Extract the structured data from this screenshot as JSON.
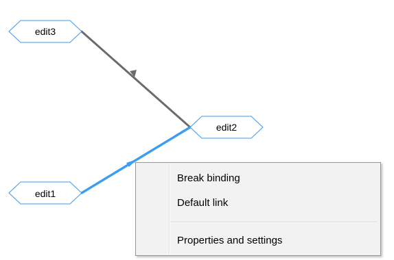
{
  "graph": {
    "nodes": [
      {
        "id": "edit3",
        "label": "edit3"
      },
      {
        "id": "edit2",
        "label": "edit2"
      },
      {
        "id": "edit1",
        "label": "edit1"
      }
    ],
    "links": [
      {
        "from": "edit3",
        "to": "edit2",
        "state": "normal",
        "color": "#6b6b6b"
      },
      {
        "from": "edit1",
        "to": "edit2",
        "state": "selected",
        "color": "#3d9df2"
      }
    ],
    "node_border_color": "#3b97e8"
  },
  "context_menu": {
    "items": [
      {
        "label": "Break binding"
      },
      {
        "label": "Default link"
      },
      {
        "separator": true
      },
      {
        "label": "Properties and settings"
      }
    ]
  }
}
